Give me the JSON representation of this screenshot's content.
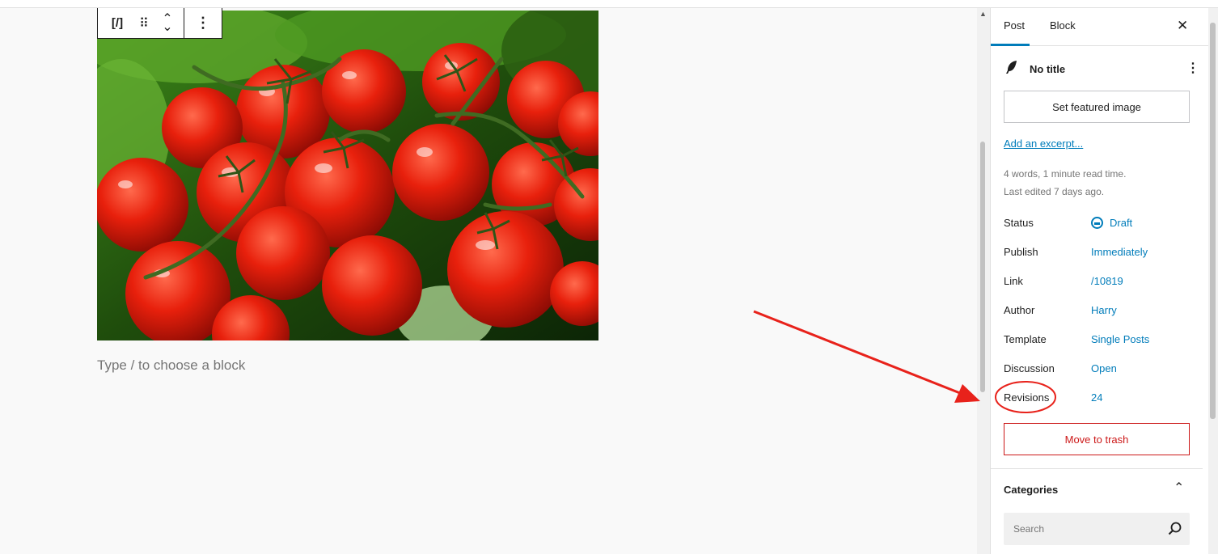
{
  "toolbar": {
    "shortcode_icon": "[/]",
    "drag_icon": "⠿",
    "move_up_icon": "⌃",
    "move_down_icon": "⌄",
    "options_icon": "⋮"
  },
  "image_block": {
    "subject": "tomatoes-photo"
  },
  "placeholder": "Type / to choose a block",
  "sidebar": {
    "tabs": [
      {
        "label": "Post"
      },
      {
        "label": "Block"
      }
    ],
    "close_icon": "✕",
    "post_title": "No title",
    "post_icon": "feather-icon",
    "post_options_icon": "⋮",
    "featured_image_label": "Set featured image",
    "excerpt_link": "Add an excerpt...",
    "meta_words": "4 words, 1 minute read time.",
    "meta_edited": "Last edited 7 days ago.",
    "rows": [
      {
        "label": "Status",
        "value": "Draft"
      },
      {
        "label": "Publish",
        "value": "Immediately"
      },
      {
        "label": "Link",
        "value": "/10819"
      },
      {
        "label": "Author",
        "value": "Harry"
      },
      {
        "label": "Template",
        "value": "Single Posts"
      },
      {
        "label": "Discussion",
        "value": "Open"
      },
      {
        "label": "Revisions",
        "value": "24"
      }
    ],
    "trash_label": "Move to trash",
    "categories_title": "Categories",
    "categories_toggle_icon": "⌃",
    "search_placeholder": "Search"
  },
  "colors": {
    "accent": "#007cba",
    "danger": "#cc1818",
    "annotation": "#e8221b"
  }
}
